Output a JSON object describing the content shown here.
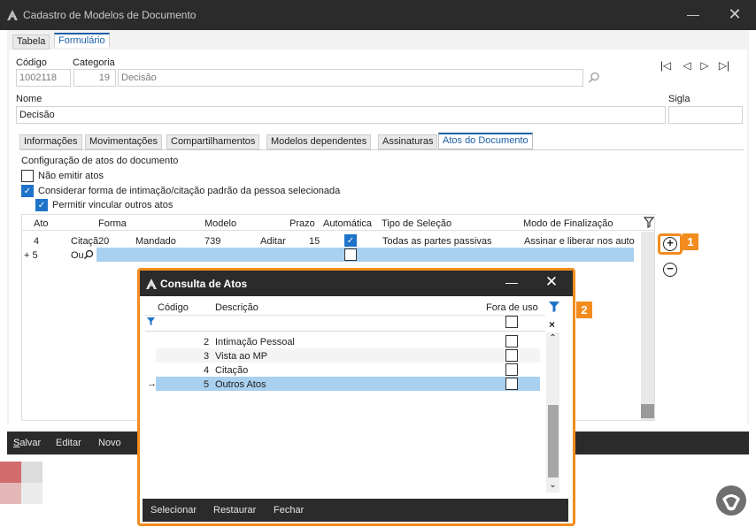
{
  "window": {
    "title": "Cadastro de Modelos de Documento"
  },
  "top_tabs": [
    "Tabela",
    "Formulário"
  ],
  "form": {
    "codigo_label": "Código",
    "codigo_value": "1002118",
    "categoria_label": "Categoria",
    "categoria_id": "19",
    "categoria_value": "Decisão",
    "nome_label": "Nome",
    "nome_value": "Decisão",
    "sigla_label": "Sigla",
    "sigla_value": ""
  },
  "nav_buttons": [
    "|◁",
    "◁",
    "▷",
    "▷|"
  ],
  "inner_tabs": [
    "Informações",
    "Movimentações",
    "Compartilhamentos",
    "Modelos dependentes",
    "Assinaturas",
    "Atos do Documento"
  ],
  "atos": {
    "section_title": "Configuração de atos do documento",
    "options": [
      {
        "label": "Não emitir atos",
        "checked": false
      },
      {
        "label": "Considerar forma de intimação/citação padrão da pessoa selecionada",
        "checked": true
      },
      {
        "label": "Permitir vincular outros atos",
        "checked": true
      }
    ]
  },
  "grid": {
    "columns": [
      "Ato",
      "Forma",
      "Modelo",
      "Prazo",
      "Automática",
      "Tipo de Seleção",
      "Modo de Finalização"
    ],
    "rows": [
      {
        "ato": "4",
        "forma_code": "Citaçã",
        "forma_num": "20",
        "forma_desc": "Mandado",
        "modelo": "739",
        "modelo_action": "Aditar",
        "prazo": "15",
        "automatica": true,
        "tipo": "Todas as partes passivas",
        "modo": "Assinar e liberar nos auto"
      },
      {
        "ato": "+ 5",
        "forma_code": "Ou",
        "forma_num": "",
        "forma_desc": "",
        "modelo": "",
        "modelo_action": "",
        "prazo": "",
        "automatica": false,
        "tipo": "",
        "modo": ""
      }
    ]
  },
  "side_buttons": {
    "add_badge": "1",
    "filter_badge": "2"
  },
  "footer": [
    "Salvar",
    "Editar",
    "Novo"
  ],
  "dialog": {
    "title": "Consulta de Atos",
    "columns": [
      "Código",
      "Descrição",
      "Fora de uso"
    ],
    "rows": [
      {
        "codigo": "2",
        "descricao": "Intimação Pessoal",
        "fora_de_uso": false,
        "selected": false
      },
      {
        "codigo": "3",
        "descricao": "Vista ao MP",
        "fora_de_uso": false,
        "selected": false
      },
      {
        "codigo": "4",
        "descricao": "Citação",
        "fora_de_uso": false,
        "selected": false
      },
      {
        "codigo": "5",
        "descricao": "Outros Atos",
        "fora_de_uso": false,
        "selected": true
      }
    ],
    "footer": [
      "Selecionar",
      "Restaurar",
      "Fechar"
    ]
  },
  "colors": {
    "accent": "#1e73c8",
    "highlight": "#f28c1e",
    "selected_row": "#a9d0ef",
    "dark": "#2b2b2b"
  }
}
